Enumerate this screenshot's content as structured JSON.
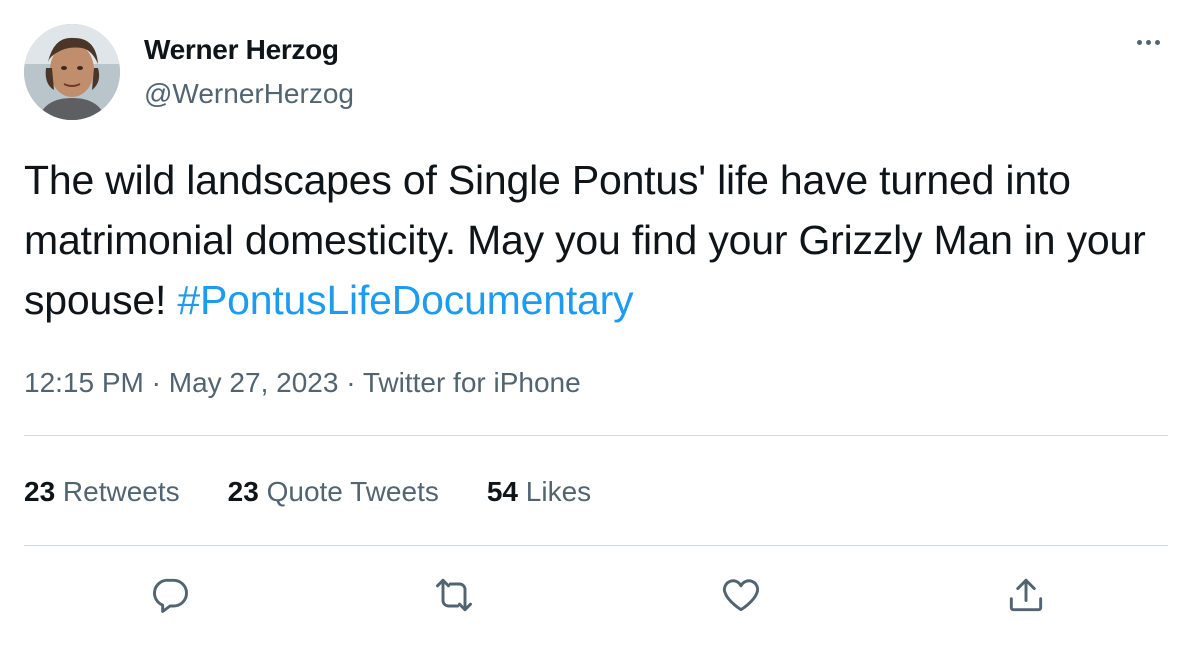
{
  "author": {
    "display_name": "Werner Herzog",
    "handle": "@WernerHerzog"
  },
  "tweet": {
    "text_before_hashtag": "The wild landscapes of Single Pontus' life have turned into matrimonial domesticity. May you find your Grizzly Man in your spouse! ",
    "hashtag": "#PontusLifeDocumentary",
    "time": "12:15 PM",
    "date": "May 27, 2023",
    "source": "Twitter for iPhone",
    "separator": " · "
  },
  "stats": {
    "retweets_count": "23",
    "retweets_label": " Retweets",
    "quotes_count": "23",
    "quotes_label": " Quote Tweets",
    "likes_count": "54",
    "likes_label": " Likes"
  },
  "icons": {
    "more": "more-icon",
    "reply": "reply-icon",
    "retweet": "retweet-icon",
    "like": "heart-icon",
    "share": "share-icon"
  },
  "colors": {
    "text": "#0f1419",
    "secondary": "#536471",
    "link": "#1d9bf0",
    "divider": "#cfd9de"
  }
}
